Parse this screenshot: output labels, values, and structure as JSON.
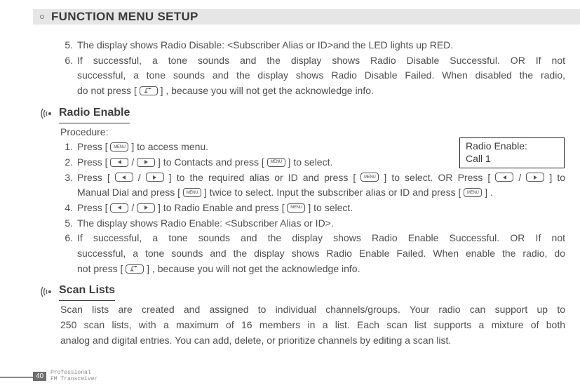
{
  "header": {
    "title": "FUNCTION MENU SETUP"
  },
  "icons": {
    "menu": "MENU"
  },
  "top_items": [
    {
      "n": "5.",
      "text": "The display shows Radio Disable: <Subscriber Alias or ID>and the LED lights up RED."
    },
    {
      "n": "6.",
      "line1": "If successful, a tone sounds and the display shows Radio Disable Successful. OR If not",
      "line2": "successful, a tone sounds and the display shows Radio Disable Failed. When disabled the radio,",
      "line3a": "do not press [ ",
      "line3b": " ] , because you will not get the acknowledge info."
    }
  ],
  "section1": {
    "title": "Radio Enable",
    "procedure": "Procedure:",
    "callout": {
      "l1": "Radio Enable:",
      "l2": "Call 1"
    },
    "s1": {
      "n": "1.",
      "a": "Press [ ",
      "b": " ] to access menu."
    },
    "s2": {
      "n": "2.",
      "a": "Press [ ",
      "b": " / ",
      "c": " ] to Contacts and press [ ",
      "d": " ]  to select."
    },
    "s3": {
      "n": "3.",
      "a": "Press [ ",
      "b": " / ",
      "c": " ] to the required alias or ID and press [ ",
      "d": " ]  to select. OR Press [ ",
      "e": " / ",
      "f": " ] to",
      "g": "Manual Dial and press [ ",
      "h": " ] twice to select. Input  the subscriber alias or ID and press [ ",
      "i": " ] ."
    },
    "s4": {
      "n": "4.",
      "a": "Press [ ",
      "b": " / ",
      "c": " ] to Radio Enable and press [ ",
      "d": " ] to select."
    },
    "s5": {
      "n": "5.",
      "text": "The display shows Radio Enable: <Subscriber Alias or ID>."
    },
    "s6": {
      "n": "6.",
      "l1": "If successful, a tone sounds and the display shows Radio Enable Successful. OR If not",
      "l2": "successful, a tone sounds and the display shows Radio Enable Failed. When enable the radio, do",
      "l3a": "not press [ ",
      "l3b": " ] , because you will not get the acknowledge info."
    }
  },
  "section2": {
    "title": "Scan Lists",
    "p1": "Scan  lists  are  created  and  assigned  to  individual channels/groups. Your radio  can  support up to",
    "p2": "250  scan  lists,  with  a maximum of 16 members in a list. Each scan list supports a mixture of both",
    "p3": "analog and digital entries. You can add, delete, or prioritize channels by editing a scan list."
  },
  "footer": {
    "page": "40",
    "l1": "Professional",
    "l2": "FM Transceiver"
  }
}
